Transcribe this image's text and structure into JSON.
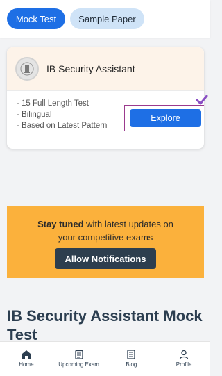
{
  "tabs": {
    "mock_test": "Mock Test",
    "sample_paper": "Sample Paper"
  },
  "exam_card": {
    "title": "IB Security Assistant",
    "features": [
      "- 15 Full Length Test",
      "- Bilingual",
      "- Based on Latest Pattern"
    ],
    "explore_label": "Explore"
  },
  "notification_banner": {
    "text_bold": "Stay tuned",
    "text_line1_rest": " with latest updates on",
    "text_line2": "your competitive exams",
    "button_label": "Allow Notifications"
  },
  "section_heading": "IB Security Assistant Mock Test",
  "bottom_nav": {
    "items": [
      {
        "label": "Home",
        "icon": "home-icon"
      },
      {
        "label": "Upcoming Exam",
        "icon": "calendar-icon"
      },
      {
        "label": "Blog",
        "icon": "blog-icon"
      },
      {
        "label": "Profile",
        "icon": "profile-icon"
      }
    ]
  },
  "colors": {
    "primary": "#1e6fe5",
    "banner": "#fbb13c",
    "dark_button": "#2d3e4e",
    "check_mark": "#8a4fc4"
  }
}
